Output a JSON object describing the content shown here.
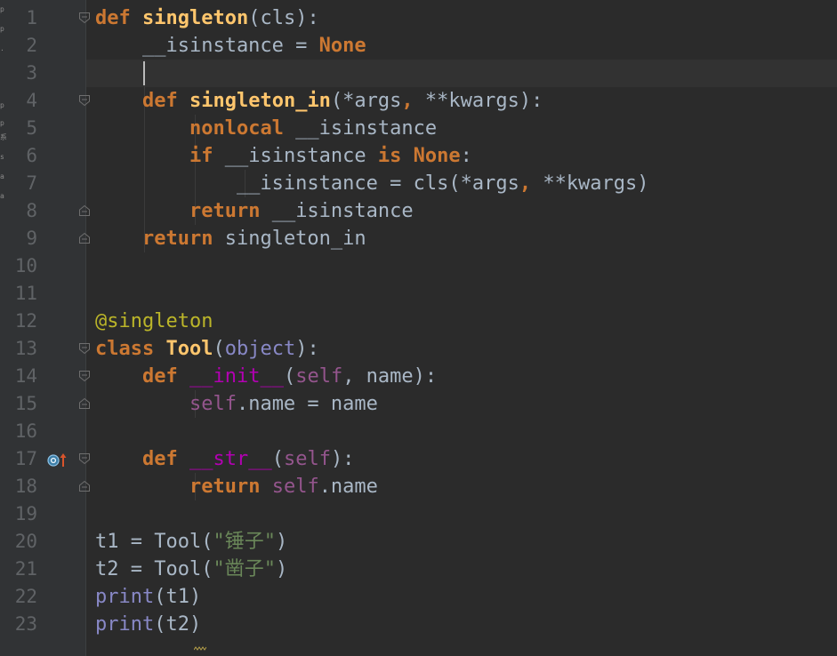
{
  "editor": {
    "language": "python",
    "caret_line": 3,
    "line_numbers": [
      "1",
      "2",
      "3",
      "4",
      "5",
      "6",
      "7",
      "8",
      "9",
      "10",
      "11",
      "12",
      "13",
      "14",
      "15",
      "16",
      "17",
      "18",
      "19",
      "20",
      "21",
      "22",
      "23"
    ],
    "lines": [
      [
        {
          "t": "def",
          "c": "kw"
        },
        {
          "t": " "
        },
        {
          "t": "singleton",
          "c": "fn"
        },
        {
          "t": "(cls):"
        }
      ],
      [
        {
          "t": "    __isinstance = "
        },
        {
          "t": "None",
          "c": "kw"
        }
      ],
      [
        {
          "t": ""
        }
      ],
      [
        {
          "t": "    "
        },
        {
          "t": "def",
          "c": "kw"
        },
        {
          "t": " "
        },
        {
          "t": "singleton_in",
          "c": "fn"
        },
        {
          "t": "(*args"
        },
        {
          "t": ",",
          "c": "kw"
        },
        {
          "t": " **kwargs):"
        }
      ],
      [
        {
          "t": "        "
        },
        {
          "t": "nonlocal",
          "c": "kw"
        },
        {
          "t": " __isinstance"
        }
      ],
      [
        {
          "t": "        "
        },
        {
          "t": "if",
          "c": "kw"
        },
        {
          "t": " __isinstance "
        },
        {
          "t": "is",
          "c": "kw"
        },
        {
          "t": " "
        },
        {
          "t": "None",
          "c": "kw"
        },
        {
          "t": ":"
        }
      ],
      [
        {
          "t": "            __isinstance = cls(*args"
        },
        {
          "t": ",",
          "c": "kw"
        },
        {
          "t": " **kwargs)"
        }
      ],
      [
        {
          "t": "        "
        },
        {
          "t": "return",
          "c": "kw"
        },
        {
          "t": " __isinstance"
        }
      ],
      [
        {
          "t": "    "
        },
        {
          "t": "return",
          "c": "kw"
        },
        {
          "t": " singleton_in"
        }
      ],
      [
        {
          "t": ""
        }
      ],
      [
        {
          "t": ""
        }
      ],
      [
        {
          "t": "@singleton",
          "c": "deco"
        }
      ],
      [
        {
          "t": "class",
          "c": "kw"
        },
        {
          "t": " "
        },
        {
          "t": "Tool",
          "c": "fn"
        },
        {
          "t": "("
        },
        {
          "t": "object",
          "c": "builtin"
        },
        {
          "t": "):"
        }
      ],
      [
        {
          "t": "    "
        },
        {
          "t": "def",
          "c": "kw"
        },
        {
          "t": " "
        },
        {
          "t": "__init__",
          "c": "magic"
        },
        {
          "t": "("
        },
        {
          "t": "self",
          "c": "self"
        },
        {
          "t": ","
        },
        {
          "t": " name):"
        }
      ],
      [
        {
          "t": "        "
        },
        {
          "t": "self",
          "c": "self"
        },
        {
          "t": ".name = name"
        }
      ],
      [
        {
          "t": ""
        }
      ],
      [
        {
          "t": "    "
        },
        {
          "t": "def",
          "c": "kw"
        },
        {
          "t": " "
        },
        {
          "t": "__str__",
          "c": "magic"
        },
        {
          "t": "("
        },
        {
          "t": "self",
          "c": "self"
        },
        {
          "t": "):"
        }
      ],
      [
        {
          "t": "        "
        },
        {
          "t": "return",
          "c": "kw"
        },
        {
          "t": " "
        },
        {
          "t": "self",
          "c": "self"
        },
        {
          "t": ".name"
        }
      ],
      [
        {
          "t": ""
        }
      ],
      [
        {
          "t": "t1 = Tool("
        },
        {
          "t": "\"锤子\"",
          "c": "str"
        },
        {
          "t": ")"
        }
      ],
      [
        {
          "t": "t2 = Tool("
        },
        {
          "t": "\"凿子\"",
          "c": "str"
        },
        {
          "t": ")"
        }
      ],
      [
        {
          "t": "print",
          "c": "builtin"
        },
        {
          "t": "(t1)"
        }
      ],
      [
        {
          "t": "print",
          "c": "builtin"
        },
        {
          "t": "(t2)"
        }
      ]
    ]
  },
  "gutter_icons": {
    "line_17": "override-method-icon"
  },
  "colors": {
    "background": "#2b2b2b",
    "gutter": "#313335",
    "keyword": "#cc7832",
    "function": "#ffc66d",
    "string": "#6a8759",
    "decorator": "#bbb529",
    "builtin": "#8888c6",
    "self": "#94558d",
    "magic": "#b200b2",
    "text": "#a9b7c6",
    "line_number": "#606366"
  },
  "left_strip_chars": [
    "p",
    "p",
    ".",
    "p",
    "p",
    "系",
    "s",
    "a",
    "a"
  ]
}
